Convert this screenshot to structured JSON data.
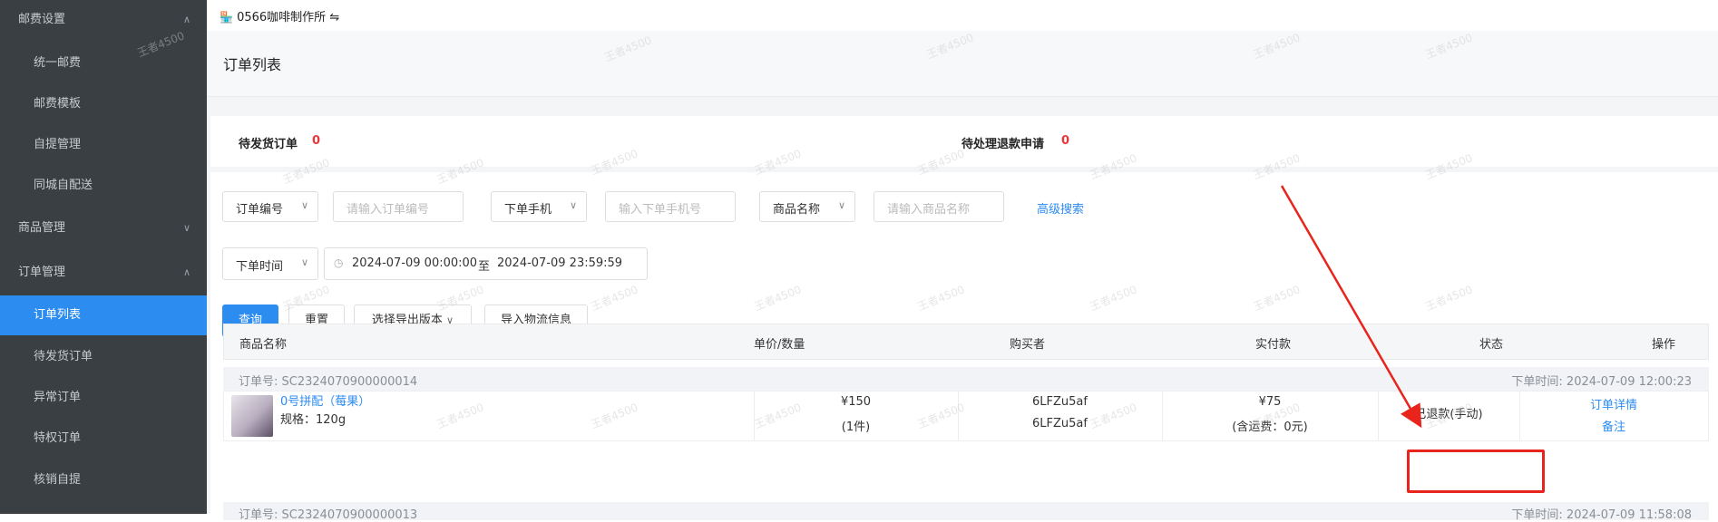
{
  "sidebar": {
    "items": [
      {
        "label": "邮费设置",
        "type": "group",
        "chevron": "up"
      },
      {
        "label": "统一邮费",
        "type": "sub"
      },
      {
        "label": "邮费模板",
        "type": "sub"
      },
      {
        "label": "自提管理",
        "type": "sub"
      },
      {
        "label": "同城自配送",
        "type": "sub"
      },
      {
        "label": "商品管理",
        "type": "group",
        "chevron": "down"
      },
      {
        "label": "订单管理",
        "type": "group",
        "chevron": "up"
      },
      {
        "label": "订单列表",
        "type": "sub",
        "active": true
      },
      {
        "label": "待发货订单",
        "type": "sub"
      },
      {
        "label": "异常订单",
        "type": "sub"
      },
      {
        "label": "特权订单",
        "type": "sub"
      },
      {
        "label": "核销自提",
        "type": "sub"
      }
    ]
  },
  "topbar": {
    "shop_name": "0566咖啡制作所",
    "switch_symbol": "⇋"
  },
  "page": {
    "title": "订单列表"
  },
  "summary": {
    "pending_ship_label": "待发货订单",
    "pending_ship_count": "0",
    "pending_refund_label": "待处理退款申请",
    "pending_refund_count": "0"
  },
  "filters": {
    "order_no_select": "订单编号",
    "order_no_placeholder": "请输入订单编号",
    "phone_select": "下单手机",
    "phone_placeholder": "输入下单手机号",
    "product_select": "商品名称",
    "product_placeholder": "请输入商品名称",
    "advanced_search": "高级搜索",
    "time_select": "下单时间",
    "date_start": "2024-07-09 00:00:00",
    "date_sep": "至",
    "date_end": "2024-07-09 23:59:59"
  },
  "actions": {
    "query": "查询",
    "reset": "重置",
    "export": "选择导出版本",
    "import_logistics": "导入物流信息"
  },
  "table": {
    "headers": {
      "product": "商品名称",
      "price_qty": "单价/数量",
      "buyer": "购买者",
      "paid": "实付款",
      "status": "状态",
      "ops": "操作"
    },
    "orders": [
      {
        "order_no": "订单号: SC2324070900000014",
        "order_time": "下单时间:  2024-07-09 12:00:23",
        "product_name": "0号拼配（莓果）",
        "spec": "规格：120g",
        "price": "¥150",
        "qty": "(1件)",
        "buyer_1": "6LFZu5af",
        "buyer_2": "6LFZu5af",
        "paid": "¥75",
        "shipping": "(含运费：0元)",
        "status": "已退款(手动)",
        "op_detail": "订单详情",
        "op_note": "备注"
      }
    ],
    "next_order_no": "订单号: SC2324070900000013",
    "next_order_time": "下单时间:  2024-07-09 11:58:08"
  },
  "watermark": "王者4500",
  "colors": {
    "sidebar_bg": "#3a3f44",
    "accent": "#2d8cf0",
    "alert": "#e4393c",
    "annotation": "#e8241c"
  }
}
